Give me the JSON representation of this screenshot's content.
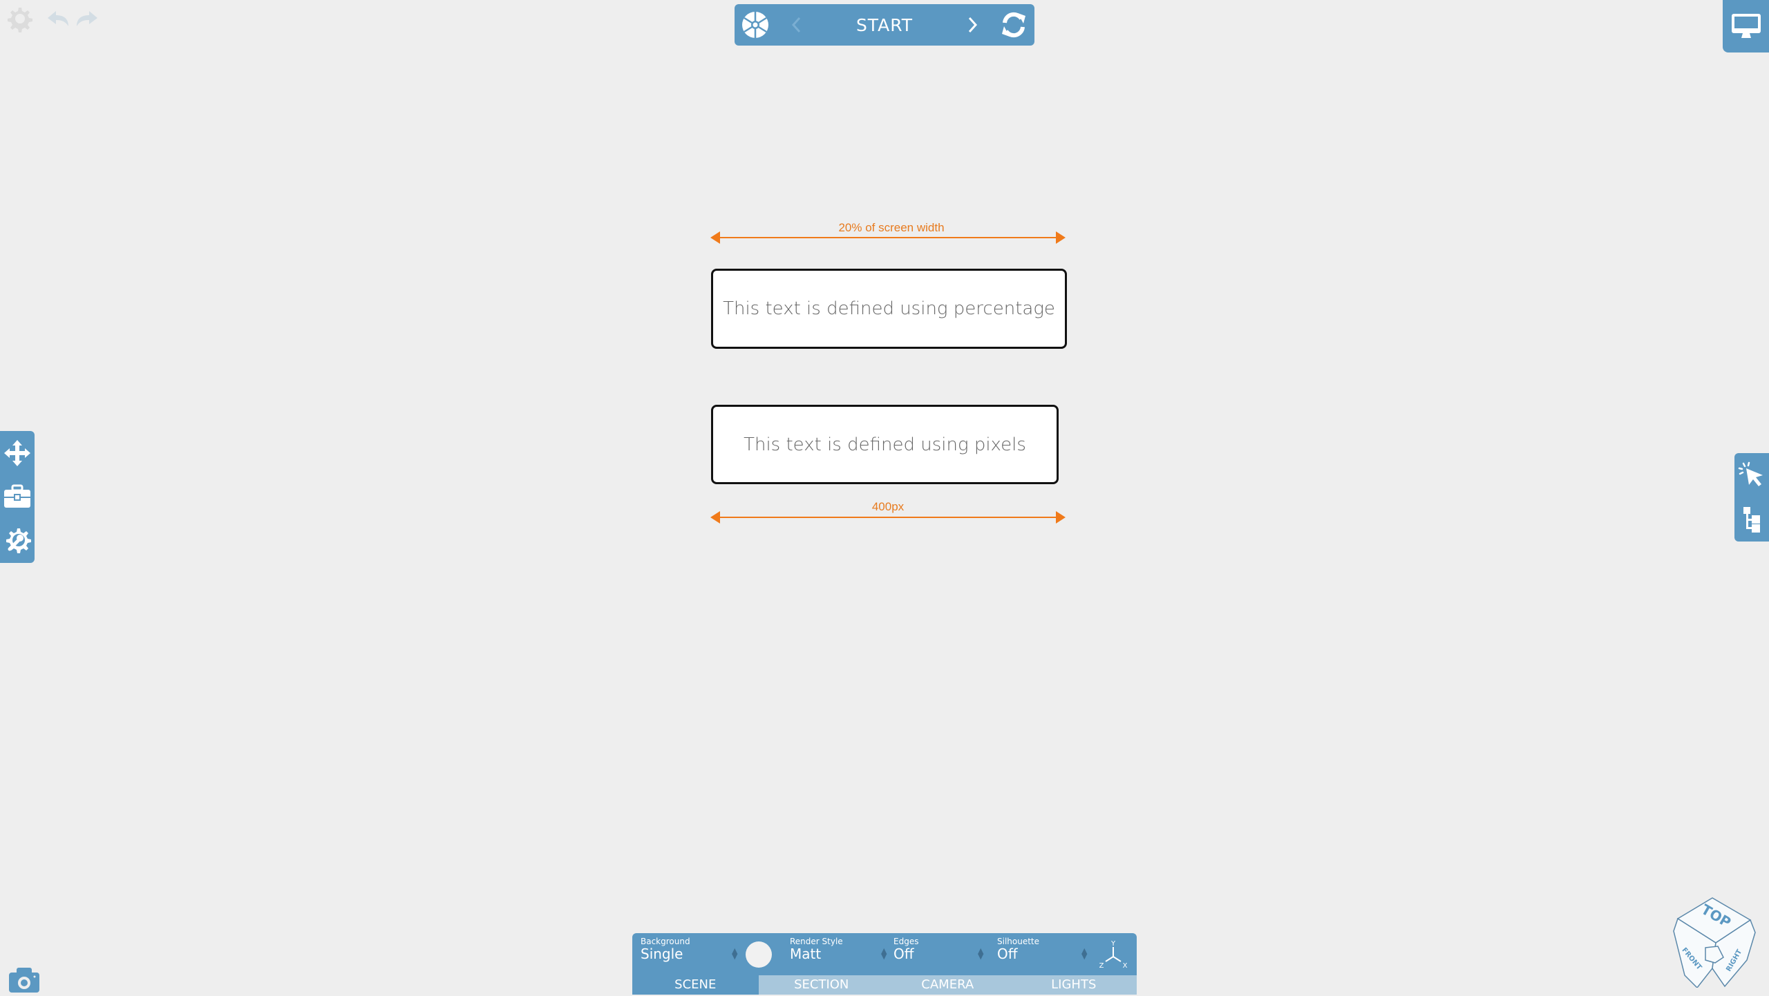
{
  "top_left": {
    "settings_icon": "gear-icon",
    "undo_icon": "undo-icon",
    "redo_icon": "redo-icon"
  },
  "top_bar": {
    "left_icon": "aperture-icon",
    "prev_icon": "chevron-left-icon",
    "title": "START",
    "next_icon": "chevron-right-icon",
    "reload_icon": "refresh-icon"
  },
  "top_right": {
    "monitor_icon": "monitor-icon"
  },
  "annotations": {
    "percent_label": "20% of screen width",
    "pixel_label": "400px",
    "accent_color": "#f07a1a"
  },
  "text_boxes": {
    "percent_text": "This text is defined using percentage",
    "pixel_text": "This text is defined using pixels"
  },
  "left_toolbar": {
    "items": [
      {
        "icon": "move-icon"
      },
      {
        "icon": "toolbox-icon"
      },
      {
        "icon": "wrench-gear-icon"
      }
    ]
  },
  "right_toolbar": {
    "items": [
      {
        "icon": "cursor-click-icon"
      },
      {
        "icon": "tree-hierarchy-icon"
      }
    ]
  },
  "bottom_panel": {
    "controls": [
      {
        "label": "Background",
        "value": "Single"
      },
      {
        "label": "Render Style",
        "value": "Matt"
      },
      {
        "label": "Edges",
        "value": "Off"
      },
      {
        "label": "Silhouette",
        "value": "Off"
      }
    ],
    "axis": {
      "y": "Y",
      "z": "Z",
      "x": "X"
    },
    "tabs": [
      {
        "label": "SCENE",
        "active": true
      },
      {
        "label": "SECTION",
        "active": false
      },
      {
        "label": "CAMERA",
        "active": false
      },
      {
        "label": "LIGHTS",
        "active": false
      }
    ]
  },
  "viewcube": {
    "top": "TOP",
    "front": "FRONT",
    "right": "RIGHT"
  },
  "theme": {
    "primary": "#5b98c2",
    "tab_inactive": "#a8c7dc",
    "background": "#eeeeee"
  }
}
